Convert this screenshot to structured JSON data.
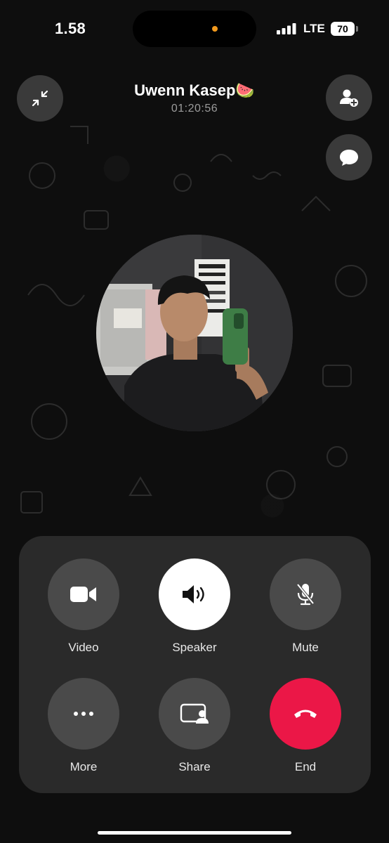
{
  "status_bar": {
    "time": "1.58",
    "carrier": "LTE",
    "battery": "70"
  },
  "call": {
    "contact_name": "Uwenn Kasep🍉",
    "duration": "01:20:56"
  },
  "header_buttons": {
    "minimize_icon": "minimize-arrows-icon",
    "add_participant_icon": "add-person-icon",
    "chat_icon": "chat-bubble-icon"
  },
  "controls": {
    "video_label": "Video",
    "speaker_label": "Speaker",
    "mute_label": "Mute",
    "more_label": "More",
    "share_label": "Share",
    "end_label": "End"
  },
  "colors": {
    "end_call": "#eb1747",
    "speaker_active": "#ffffff",
    "control_bg": "#4a4a4a",
    "panel_bg": "#2a2a2a"
  }
}
